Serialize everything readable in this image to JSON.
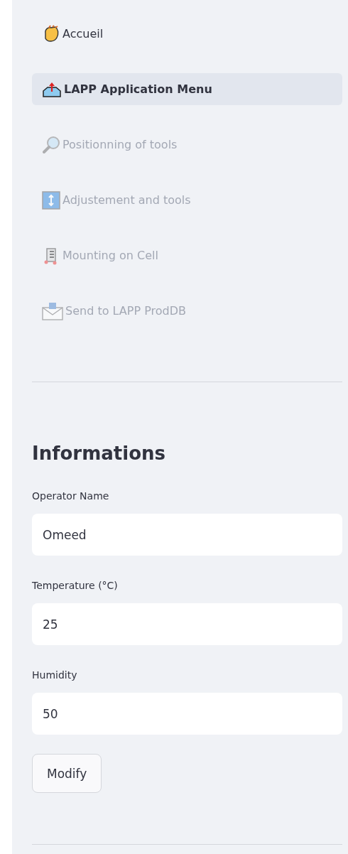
{
  "sidebar": {
    "nav_items": [
      {
        "label": "Accueil",
        "selected": false,
        "disabled": false
      },
      {
        "label": "LAPP Application Menu",
        "selected": true,
        "disabled": false
      },
      {
        "label": "Positionning of tools",
        "selected": false,
        "disabled": true
      },
      {
        "label": "Adjustement and tools",
        "selected": false,
        "disabled": true
      },
      {
        "label": "Mounting on Cell",
        "selected": false,
        "disabled": true
      },
      {
        "label": "Send to LAPP ProdDB",
        "selected": false,
        "disabled": true
      }
    ],
    "heading": "Informations",
    "fields": [
      {
        "label": "Operator Name",
        "value": "Omeed"
      },
      {
        "label": "Temperature (°C)",
        "value": "25"
      },
      {
        "label": "Humidity",
        "value": "50"
      }
    ],
    "button": "Modify"
  }
}
